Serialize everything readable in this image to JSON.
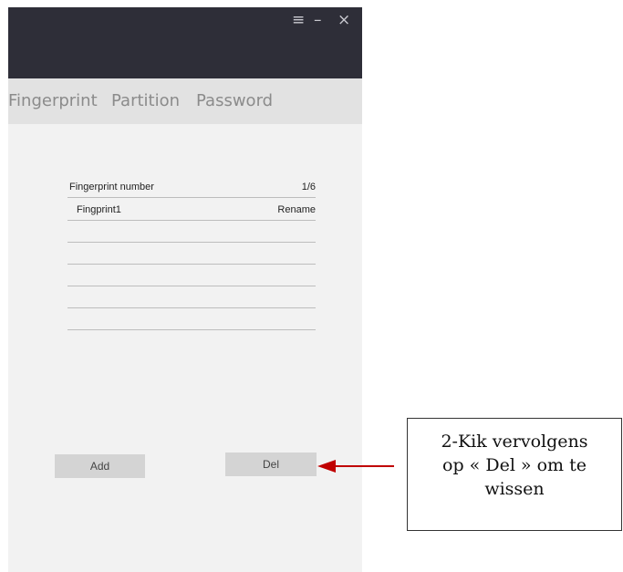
{
  "window": {
    "controls": {
      "menu": "≡",
      "minimize": "–",
      "close": "×"
    }
  },
  "tabs": [
    "Fingerprint",
    "Partition",
    "Password"
  ],
  "list": {
    "header_label": "Fingerprint number",
    "count": "1/6",
    "items": [
      {
        "name": "Fingprint1",
        "action": "Rename"
      }
    ],
    "empty_rows": 5
  },
  "buttons": {
    "add": "Add",
    "del": "Del"
  },
  "callout": {
    "lines": [
      "2-Kik vervolgens",
      "op « Del » om te",
      "wissen"
    ]
  },
  "colors": {
    "titlebar": "#2e2e38",
    "tabs_bg": "#e2e2e2",
    "panel_bg": "#f2f2f2",
    "button_bg": "#d4d4d4",
    "arrow": "#c00000"
  }
}
